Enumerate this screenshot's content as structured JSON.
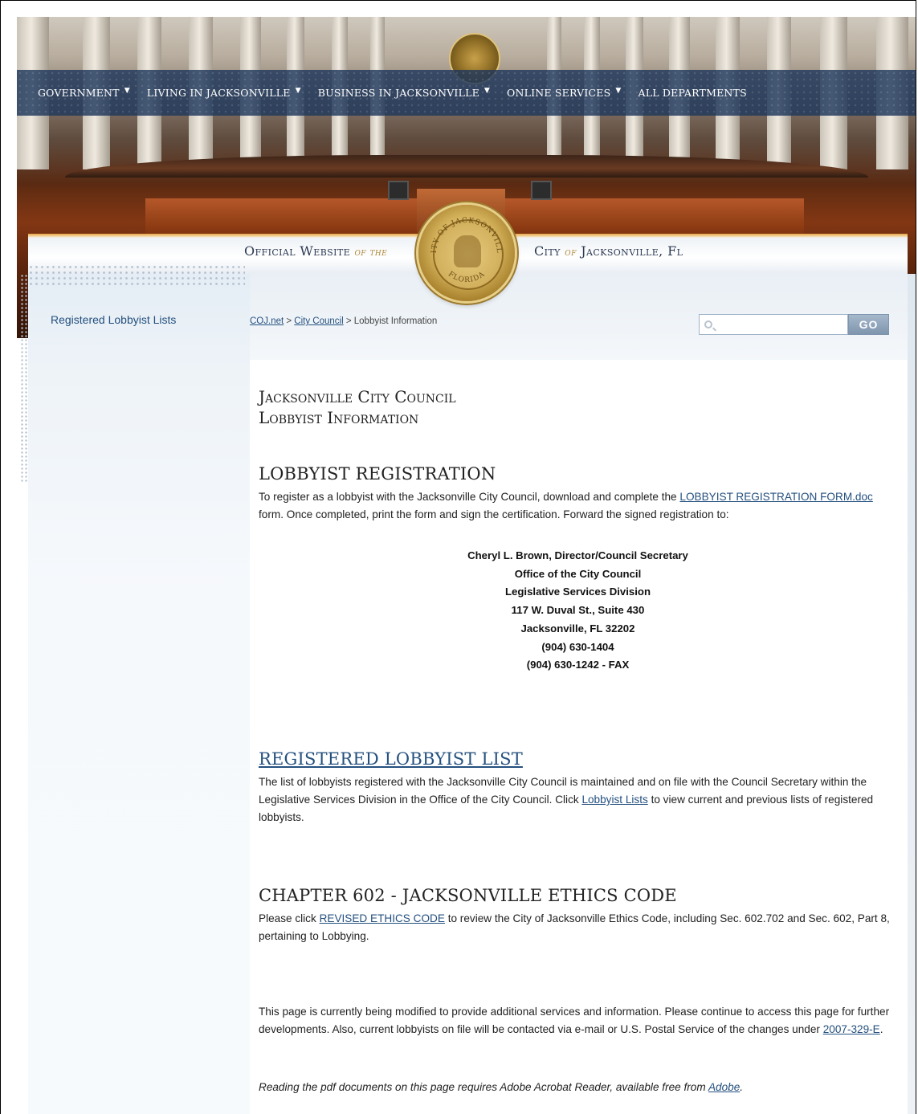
{
  "nav": {
    "items": [
      {
        "label": "GOVERNMENT",
        "has_dropdown": true
      },
      {
        "label": "LIVING IN JACKSONVILLE",
        "has_dropdown": true
      },
      {
        "label": "BUSINESS IN JACKSONVILLE",
        "has_dropdown": true
      },
      {
        "label": "ONLINE SERVICES",
        "has_dropdown": true
      },
      {
        "label": "ALL DEPARTMENTS",
        "has_dropdown": false
      }
    ],
    "caret": "▼"
  },
  "banner": {
    "left_main": "Official Website",
    "left_of": "of the",
    "right_main_1": "City",
    "right_of": "of",
    "right_main_2": "Jacksonville, Fl"
  },
  "seal": {
    "top_text": "CITY OF JACKSONVILLE",
    "bottom_text": "FLORIDA"
  },
  "sidebar": {
    "items": [
      {
        "label": "Registered Lobbyist Lists"
      }
    ]
  },
  "breadcrumb": {
    "items": [
      "COJ.net",
      "City Council"
    ],
    "current": "Lobbyist Information",
    "separator": " > "
  },
  "search": {
    "placeholder": "",
    "value": "",
    "button_label": "GO"
  },
  "page": {
    "title_line_1": "Jacksonville City Council",
    "title_line_2": "Lobbyist Information"
  },
  "registration": {
    "heading": "LOBBYIST REGISTRATION",
    "text_before": "To register as a lobbyist with the Jacksonville City Council, download and complete the ",
    "link": "LOBBYIST REGISTRATION FORM.doc",
    "text_after": " form. Once completed, print the form and sign the certification. Forward the signed registration to:",
    "address": [
      "Cheryl L. Brown, Director/Council Secretary",
      "Office of the City Council",
      "Legislative Services Division",
      "117 W. Duval St., Suite 430",
      "Jacksonville, FL 32202",
      "(904) 630-1404",
      "(904) 630-1242 - FAX"
    ]
  },
  "registered_list": {
    "heading": "REGISTERED LOBBYIST LIST",
    "text_before": "The list of lobbyists registered with the Jacksonville City Council is maintained and on file with the Council Secretary within the Legislative Services Division in the Office of the City Council. Click ",
    "link": "Lobbyist Lists",
    "text_after": " to view current and previous lists of registered lobbyists."
  },
  "ethics": {
    "heading": "CHAPTER 602 - JACKSONVILLE ETHICS CODE",
    "text_before": "Please click ",
    "link": "REVISED ETHICS CODE",
    "text_after": " to review the City of Jacksonville Ethics Code, including Sec. 602.702 and Sec. 602, Part 8, pertaining to Lobbying."
  },
  "notice": {
    "text_before": "This page is currently being modified to provide additional services and information. Please continue to access this page for further developments. Also, current lobbyists on file will be contacted via e-mail or U.S. Postal Service of the changes under ",
    "link": "2007-329-E",
    "text_after": "."
  },
  "adobe": {
    "text_before": "Reading the pdf documents on this page requires Adobe Acrobat Reader, available free from ",
    "link": "Adobe",
    "text_after": "."
  }
}
